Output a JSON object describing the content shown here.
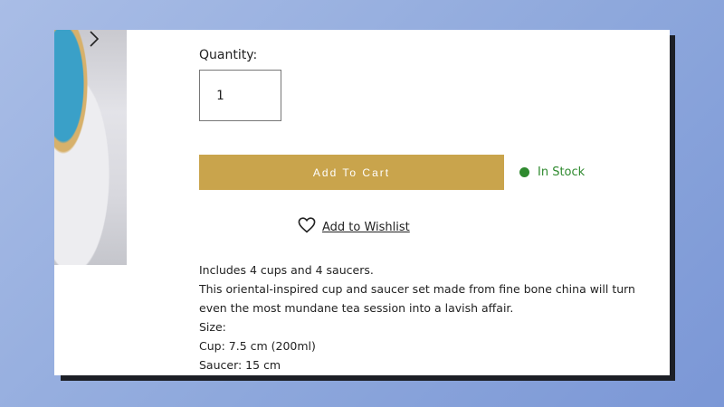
{
  "quantity": {
    "label": "Quantity:",
    "value": "1"
  },
  "cart": {
    "add_label": "Add To Cart"
  },
  "stock": {
    "label": "In Stock",
    "color": "#2f8a2f"
  },
  "wishlist": {
    "label": "Add to Wishlist",
    "icon": "heart-icon"
  },
  "description": {
    "lines": [
      "Includes 4 cups and 4 saucers.",
      "This oriental-inspired cup and saucer set made from fine bone china will turn even the most mundane tea session into a lavish affair.",
      "Size:",
      "Cup: 7.5 cm (200ml)",
      "Saucer: 15 cm"
    ]
  },
  "colors": {
    "accent": "#c9a44c",
    "background": "#8ea8dc"
  },
  "image": {
    "nav_icon": "chevron-right-icon"
  }
}
